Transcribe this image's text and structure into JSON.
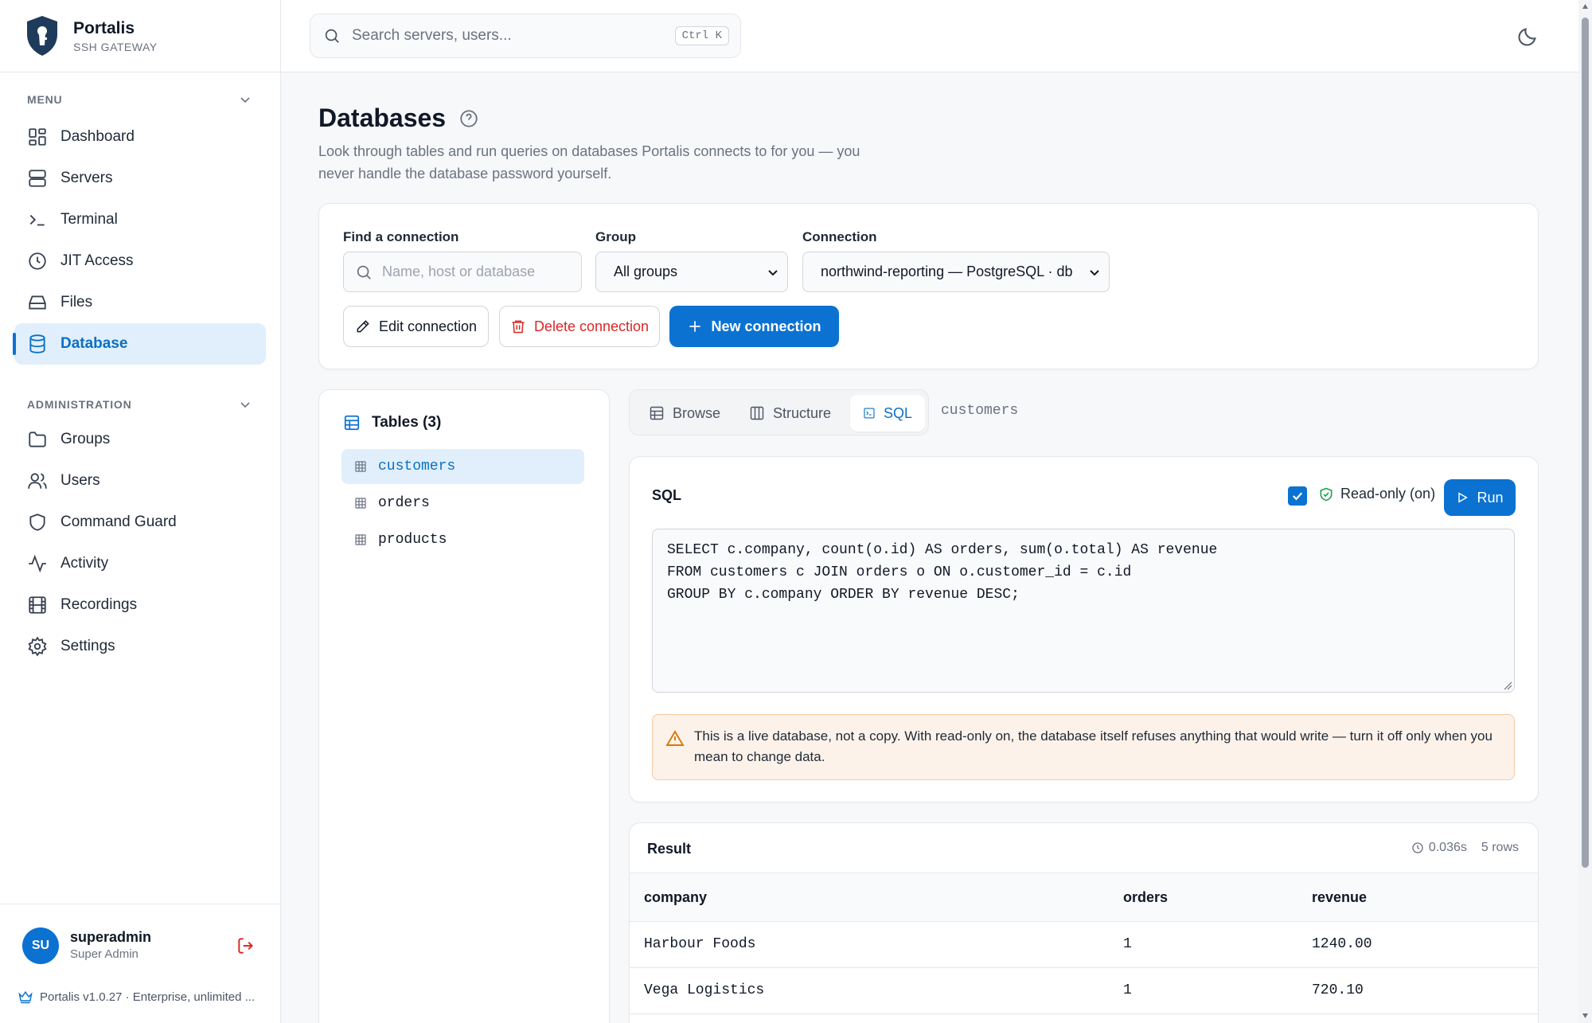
{
  "app": {
    "name": "Portalis",
    "subtitle": "SSH GATEWAY"
  },
  "topbar": {
    "search_placeholder": "Search servers, users...",
    "shortcut": "Ctrl K"
  },
  "sidebar": {
    "menu_heading": "MENU",
    "menu_items": [
      {
        "label": "Dashboard",
        "icon": "dashboard-icon",
        "active": false
      },
      {
        "label": "Servers",
        "icon": "servers-icon",
        "active": false
      },
      {
        "label": "Terminal",
        "icon": "terminal-icon",
        "active": false
      },
      {
        "label": "JIT Access",
        "icon": "clock-icon",
        "active": false
      },
      {
        "label": "Files",
        "icon": "drive-icon",
        "active": false
      },
      {
        "label": "Database",
        "icon": "database-icon",
        "active": true
      }
    ],
    "admin_heading": "ADMINISTRATION",
    "admin_items": [
      {
        "label": "Groups",
        "icon": "folder-icon"
      },
      {
        "label": "Users",
        "icon": "users-icon"
      },
      {
        "label": "Command Guard",
        "icon": "shield-icon"
      },
      {
        "label": "Activity",
        "icon": "activity-icon"
      },
      {
        "label": "Recordings",
        "icon": "film-icon"
      },
      {
        "label": "Settings",
        "icon": "gear-icon"
      }
    ],
    "user": {
      "initials": "SU",
      "name": "superadmin",
      "role": "Super Admin"
    },
    "version": "Portalis v1.0.27 · Enterprise, unlimited ..."
  },
  "page": {
    "title": "Databases",
    "description": "Look through tables and run queries on databases Portalis connects to for you — you never handle the database password yourself."
  },
  "connection": {
    "find_label": "Find a connection",
    "find_placeholder": "Name, host or database",
    "group_label": "Group",
    "group_value": "All groups",
    "connection_label": "Connection",
    "connection_value": "northwind-reporting — PostgreSQL · db",
    "edit_label": "Edit connection",
    "delete_label": "Delete connection",
    "new_label": "New connection"
  },
  "tables": {
    "title": "Tables (3)",
    "items": [
      "customers",
      "orders",
      "products"
    ],
    "active": "customers"
  },
  "tabs": {
    "items": [
      "Browse",
      "Structure",
      "SQL"
    ],
    "active": "SQL",
    "current_table": "customers"
  },
  "sql": {
    "title": "SQL",
    "readonly_label": "Read-only (on)",
    "readonly_checked": true,
    "run_label": "Run",
    "query_lines": [
      "SELECT c.company, count(o.id) AS orders, sum(o.total) AS revenue",
      "FROM customers c JOIN orders o ON o.customer_id = c.id",
      "GROUP BY c.company ORDER BY revenue DESC;"
    ],
    "warning": "This is a live database, not a copy. With read-only on, the database itself refuses anything that would write — turn it off only when you mean to change data."
  },
  "result": {
    "title": "Result",
    "time": "0.036s",
    "rows_count": "5 rows",
    "columns": [
      "company",
      "orders",
      "revenue"
    ],
    "rows": [
      [
        "Harbour Foods",
        "1",
        "1240.00"
      ],
      [
        "Vega Logistics",
        "1",
        "720.10"
      ]
    ]
  },
  "colors": {
    "accent": "#0b72d1",
    "danger": "#dc2626",
    "warning_bg": "#fdf2e9"
  }
}
